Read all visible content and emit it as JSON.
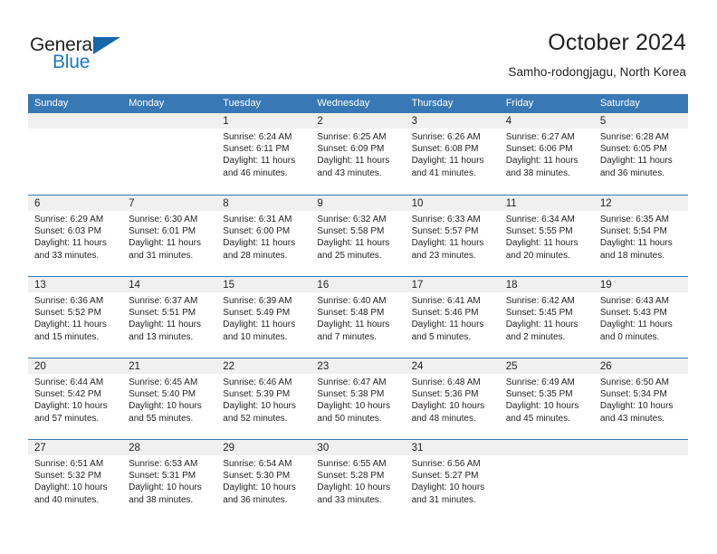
{
  "brand": {
    "word_one": "General",
    "word_two": "Blue",
    "flag_color": "#1566ab",
    "blue_color": "#1f78c1"
  },
  "header": {
    "title": "October 2024",
    "subtitle": "Samho-rodongjagu, North Korea"
  },
  "theme": {
    "header_blue": "#3878b4",
    "daynum_band": "#f0f0f0",
    "text": "#231f20"
  },
  "weekdays": [
    "Sunday",
    "Monday",
    "Tuesday",
    "Wednesday",
    "Thursday",
    "Friday",
    "Saturday"
  ],
  "weeks": [
    [
      {
        "day": "",
        "info": ""
      },
      {
        "day": "",
        "info": ""
      },
      {
        "day": "1",
        "info": "Sunrise: 6:24 AM\nSunset: 6:11 PM\nDaylight: 11 hours\nand 46 minutes."
      },
      {
        "day": "2",
        "info": "Sunrise: 6:25 AM\nSunset: 6:09 PM\nDaylight: 11 hours\nand 43 minutes."
      },
      {
        "day": "3",
        "info": "Sunrise: 6:26 AM\nSunset: 6:08 PM\nDaylight: 11 hours\nand 41 minutes."
      },
      {
        "day": "4",
        "info": "Sunrise: 6:27 AM\nSunset: 6:06 PM\nDaylight: 11 hours\nand 38 minutes."
      },
      {
        "day": "5",
        "info": "Sunrise: 6:28 AM\nSunset: 6:05 PM\nDaylight: 11 hours\nand 36 minutes."
      }
    ],
    [
      {
        "day": "6",
        "info": "Sunrise: 6:29 AM\nSunset: 6:03 PM\nDaylight: 11 hours\nand 33 minutes."
      },
      {
        "day": "7",
        "info": "Sunrise: 6:30 AM\nSunset: 6:01 PM\nDaylight: 11 hours\nand 31 minutes."
      },
      {
        "day": "8",
        "info": "Sunrise: 6:31 AM\nSunset: 6:00 PM\nDaylight: 11 hours\nand 28 minutes."
      },
      {
        "day": "9",
        "info": "Sunrise: 6:32 AM\nSunset: 5:58 PM\nDaylight: 11 hours\nand 25 minutes."
      },
      {
        "day": "10",
        "info": "Sunrise: 6:33 AM\nSunset: 5:57 PM\nDaylight: 11 hours\nand 23 minutes."
      },
      {
        "day": "11",
        "info": "Sunrise: 6:34 AM\nSunset: 5:55 PM\nDaylight: 11 hours\nand 20 minutes."
      },
      {
        "day": "12",
        "info": "Sunrise: 6:35 AM\nSunset: 5:54 PM\nDaylight: 11 hours\nand 18 minutes."
      }
    ],
    [
      {
        "day": "13",
        "info": "Sunrise: 6:36 AM\nSunset: 5:52 PM\nDaylight: 11 hours\nand 15 minutes."
      },
      {
        "day": "14",
        "info": "Sunrise: 6:37 AM\nSunset: 5:51 PM\nDaylight: 11 hours\nand 13 minutes."
      },
      {
        "day": "15",
        "info": "Sunrise: 6:39 AM\nSunset: 5:49 PM\nDaylight: 11 hours\nand 10 minutes."
      },
      {
        "day": "16",
        "info": "Sunrise: 6:40 AM\nSunset: 5:48 PM\nDaylight: 11 hours\nand 7 minutes."
      },
      {
        "day": "17",
        "info": "Sunrise: 6:41 AM\nSunset: 5:46 PM\nDaylight: 11 hours\nand 5 minutes."
      },
      {
        "day": "18",
        "info": "Sunrise: 6:42 AM\nSunset: 5:45 PM\nDaylight: 11 hours\nand 2 minutes."
      },
      {
        "day": "19",
        "info": "Sunrise: 6:43 AM\nSunset: 5:43 PM\nDaylight: 11 hours\nand 0 minutes."
      }
    ],
    [
      {
        "day": "20",
        "info": "Sunrise: 6:44 AM\nSunset: 5:42 PM\nDaylight: 10 hours\nand 57 minutes."
      },
      {
        "day": "21",
        "info": "Sunrise: 6:45 AM\nSunset: 5:40 PM\nDaylight: 10 hours\nand 55 minutes."
      },
      {
        "day": "22",
        "info": "Sunrise: 6:46 AM\nSunset: 5:39 PM\nDaylight: 10 hours\nand 52 minutes."
      },
      {
        "day": "23",
        "info": "Sunrise: 6:47 AM\nSunset: 5:38 PM\nDaylight: 10 hours\nand 50 minutes."
      },
      {
        "day": "24",
        "info": "Sunrise: 6:48 AM\nSunset: 5:36 PM\nDaylight: 10 hours\nand 48 minutes."
      },
      {
        "day": "25",
        "info": "Sunrise: 6:49 AM\nSunset: 5:35 PM\nDaylight: 10 hours\nand 45 minutes."
      },
      {
        "day": "26",
        "info": "Sunrise: 6:50 AM\nSunset: 5:34 PM\nDaylight: 10 hours\nand 43 minutes."
      }
    ],
    [
      {
        "day": "27",
        "info": "Sunrise: 6:51 AM\nSunset: 5:32 PM\nDaylight: 10 hours\nand 40 minutes."
      },
      {
        "day": "28",
        "info": "Sunrise: 6:53 AM\nSunset: 5:31 PM\nDaylight: 10 hours\nand 38 minutes."
      },
      {
        "day": "29",
        "info": "Sunrise: 6:54 AM\nSunset: 5:30 PM\nDaylight: 10 hours\nand 36 minutes."
      },
      {
        "day": "30",
        "info": "Sunrise: 6:55 AM\nSunset: 5:28 PM\nDaylight: 10 hours\nand 33 minutes."
      },
      {
        "day": "31",
        "info": "Sunrise: 6:56 AM\nSunset: 5:27 PM\nDaylight: 10 hours\nand 31 minutes."
      },
      {
        "day": "",
        "info": ""
      },
      {
        "day": "",
        "info": ""
      }
    ]
  ]
}
